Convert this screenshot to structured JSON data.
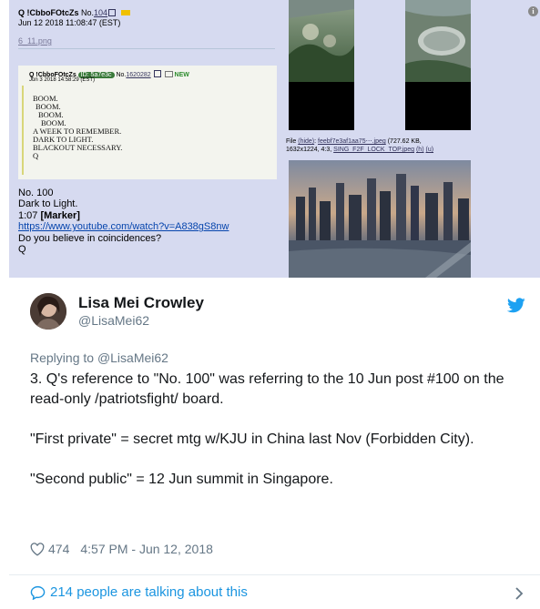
{
  "embed": {
    "post_header": {
      "name": "Q !CbboFOtcZs",
      "no_label": "No.",
      "no_value": "104"
    },
    "post_date": "Jun 12 2018 11:08:47 (EST)",
    "file_link": "6_11.png",
    "inner": {
      "name": "Q !CbboFOtcZs",
      "id_badge": "ID: 5a7e3c",
      "no_label": "No.",
      "no_value": "1620282",
      "new_badge": "NEW",
      "date": "Jun 3 2018 14:58:29 (EST)",
      "lines": [
        "BOOM.",
        "BOOM.",
        "BOOM.",
        "BOOM.",
        "A WEEK TO REMEMBER.",
        "DARK TO LIGHT.",
        "BLACKOUT NECESSARY.",
        "Q"
      ]
    },
    "main_lines": {
      "l1": "No. 100",
      "l2": "Dark to Light.",
      "l3_time": "1:07",
      "l3_marker": "[Marker]",
      "l4_link": "https://www.youtube.com/watch?v=A838gS8nw",
      "l5": "Do you believe in coincidences?",
      "l6": "Q"
    },
    "file_caption": {
      "prefix": "File",
      "hide": "(hide)",
      "filename": "feebf7e3af1aa75⋯.jpeg",
      "size": "(727.62 KB,",
      "dims": "1632x1224, 4:3,",
      "orig_name": "SING_F2F_LOCK_TOP.jpeg",
      "h": "(h)",
      "u": "(u)"
    },
    "info_glyph": "i"
  },
  "tweet": {
    "display_name": "Lisa Mei Crowley",
    "handle": "@LisaMei62",
    "reply_prefix": "Replying to",
    "reply_to": "@LisaMei62",
    "paragraphs": [
      "3. Q's reference to \"No. 100\" was referring to the 10 Jun post #100 on the read-only /patriotsfight/ board.",
      "\"First private\" = secret mtg w/KJU in China last Nov (Forbidden City).",
      "\"Second public\" = 12 Jun summit in Singapore."
    ],
    "likes": "474",
    "timestamp": "4:57 PM - Jun 12, 2018",
    "talking": "214 people are talking about this"
  },
  "colors": {
    "twitter_blue": "#1da1f2",
    "link_blue": "#1b95e0",
    "muted": "#657786",
    "board_bg": "#d6daf0"
  },
  "icons": [
    "external-link-icon",
    "flag-icon",
    "info-icon",
    "twitter-bird-icon",
    "heart-icon",
    "speech-bubble-icon",
    "chevron-right-icon"
  ]
}
